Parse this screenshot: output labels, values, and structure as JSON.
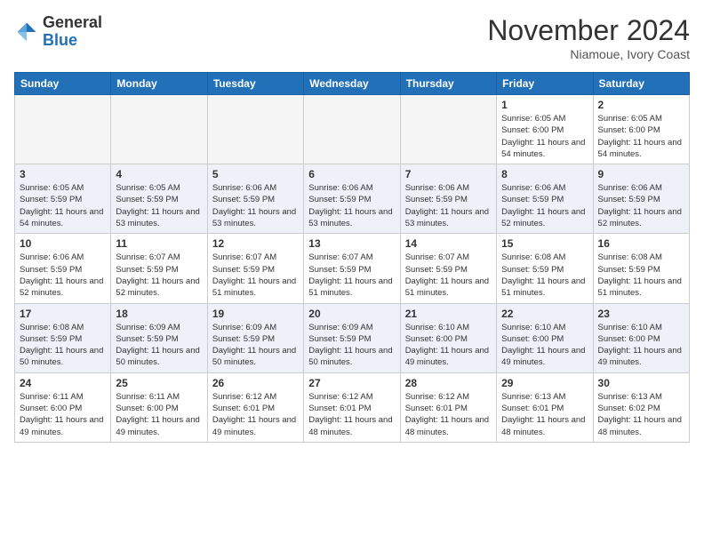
{
  "header": {
    "logo": {
      "general": "General",
      "blue": "Blue"
    },
    "month": "November 2024",
    "location": "Niamoue, Ivory Coast"
  },
  "weekdays": [
    "Sunday",
    "Monday",
    "Tuesday",
    "Wednesday",
    "Thursday",
    "Friday",
    "Saturday"
  ],
  "weeks": [
    [
      {
        "day": "",
        "empty": true
      },
      {
        "day": "",
        "empty": true
      },
      {
        "day": "",
        "empty": true
      },
      {
        "day": "",
        "empty": true
      },
      {
        "day": "",
        "empty": true
      },
      {
        "day": "1",
        "sunrise": "6:05 AM",
        "sunset": "6:00 PM",
        "daylight": "11 hours and 54 minutes."
      },
      {
        "day": "2",
        "sunrise": "6:05 AM",
        "sunset": "6:00 PM",
        "daylight": "11 hours and 54 minutes."
      }
    ],
    [
      {
        "day": "3",
        "sunrise": "6:05 AM",
        "sunset": "5:59 PM",
        "daylight": "11 hours and 54 minutes."
      },
      {
        "day": "4",
        "sunrise": "6:05 AM",
        "sunset": "5:59 PM",
        "daylight": "11 hours and 53 minutes."
      },
      {
        "day": "5",
        "sunrise": "6:06 AM",
        "sunset": "5:59 PM",
        "daylight": "11 hours and 53 minutes."
      },
      {
        "day": "6",
        "sunrise": "6:06 AM",
        "sunset": "5:59 PM",
        "daylight": "11 hours and 53 minutes."
      },
      {
        "day": "7",
        "sunrise": "6:06 AM",
        "sunset": "5:59 PM",
        "daylight": "11 hours and 53 minutes."
      },
      {
        "day": "8",
        "sunrise": "6:06 AM",
        "sunset": "5:59 PM",
        "daylight": "11 hours and 52 minutes."
      },
      {
        "day": "9",
        "sunrise": "6:06 AM",
        "sunset": "5:59 PM",
        "daylight": "11 hours and 52 minutes."
      }
    ],
    [
      {
        "day": "10",
        "sunrise": "6:06 AM",
        "sunset": "5:59 PM",
        "daylight": "11 hours and 52 minutes."
      },
      {
        "day": "11",
        "sunrise": "6:07 AM",
        "sunset": "5:59 PM",
        "daylight": "11 hours and 52 minutes."
      },
      {
        "day": "12",
        "sunrise": "6:07 AM",
        "sunset": "5:59 PM",
        "daylight": "11 hours and 51 minutes."
      },
      {
        "day": "13",
        "sunrise": "6:07 AM",
        "sunset": "5:59 PM",
        "daylight": "11 hours and 51 minutes."
      },
      {
        "day": "14",
        "sunrise": "6:07 AM",
        "sunset": "5:59 PM",
        "daylight": "11 hours and 51 minutes."
      },
      {
        "day": "15",
        "sunrise": "6:08 AM",
        "sunset": "5:59 PM",
        "daylight": "11 hours and 51 minutes."
      },
      {
        "day": "16",
        "sunrise": "6:08 AM",
        "sunset": "5:59 PM",
        "daylight": "11 hours and 51 minutes."
      }
    ],
    [
      {
        "day": "17",
        "sunrise": "6:08 AM",
        "sunset": "5:59 PM",
        "daylight": "11 hours and 50 minutes."
      },
      {
        "day": "18",
        "sunrise": "6:09 AM",
        "sunset": "5:59 PM",
        "daylight": "11 hours and 50 minutes."
      },
      {
        "day": "19",
        "sunrise": "6:09 AM",
        "sunset": "5:59 PM",
        "daylight": "11 hours and 50 minutes."
      },
      {
        "day": "20",
        "sunrise": "6:09 AM",
        "sunset": "5:59 PM",
        "daylight": "11 hours and 50 minutes."
      },
      {
        "day": "21",
        "sunrise": "6:10 AM",
        "sunset": "6:00 PM",
        "daylight": "11 hours and 49 minutes."
      },
      {
        "day": "22",
        "sunrise": "6:10 AM",
        "sunset": "6:00 PM",
        "daylight": "11 hours and 49 minutes."
      },
      {
        "day": "23",
        "sunrise": "6:10 AM",
        "sunset": "6:00 PM",
        "daylight": "11 hours and 49 minutes."
      }
    ],
    [
      {
        "day": "24",
        "sunrise": "6:11 AM",
        "sunset": "6:00 PM",
        "daylight": "11 hours and 49 minutes."
      },
      {
        "day": "25",
        "sunrise": "6:11 AM",
        "sunset": "6:00 PM",
        "daylight": "11 hours and 49 minutes."
      },
      {
        "day": "26",
        "sunrise": "6:12 AM",
        "sunset": "6:01 PM",
        "daylight": "11 hours and 49 minutes."
      },
      {
        "day": "27",
        "sunrise": "6:12 AM",
        "sunset": "6:01 PM",
        "daylight": "11 hours and 48 minutes."
      },
      {
        "day": "28",
        "sunrise": "6:12 AM",
        "sunset": "6:01 PM",
        "daylight": "11 hours and 48 minutes."
      },
      {
        "day": "29",
        "sunrise": "6:13 AM",
        "sunset": "6:01 PM",
        "daylight": "11 hours and 48 minutes."
      },
      {
        "day": "30",
        "sunrise": "6:13 AM",
        "sunset": "6:02 PM",
        "daylight": "11 hours and 48 minutes."
      }
    ]
  ]
}
